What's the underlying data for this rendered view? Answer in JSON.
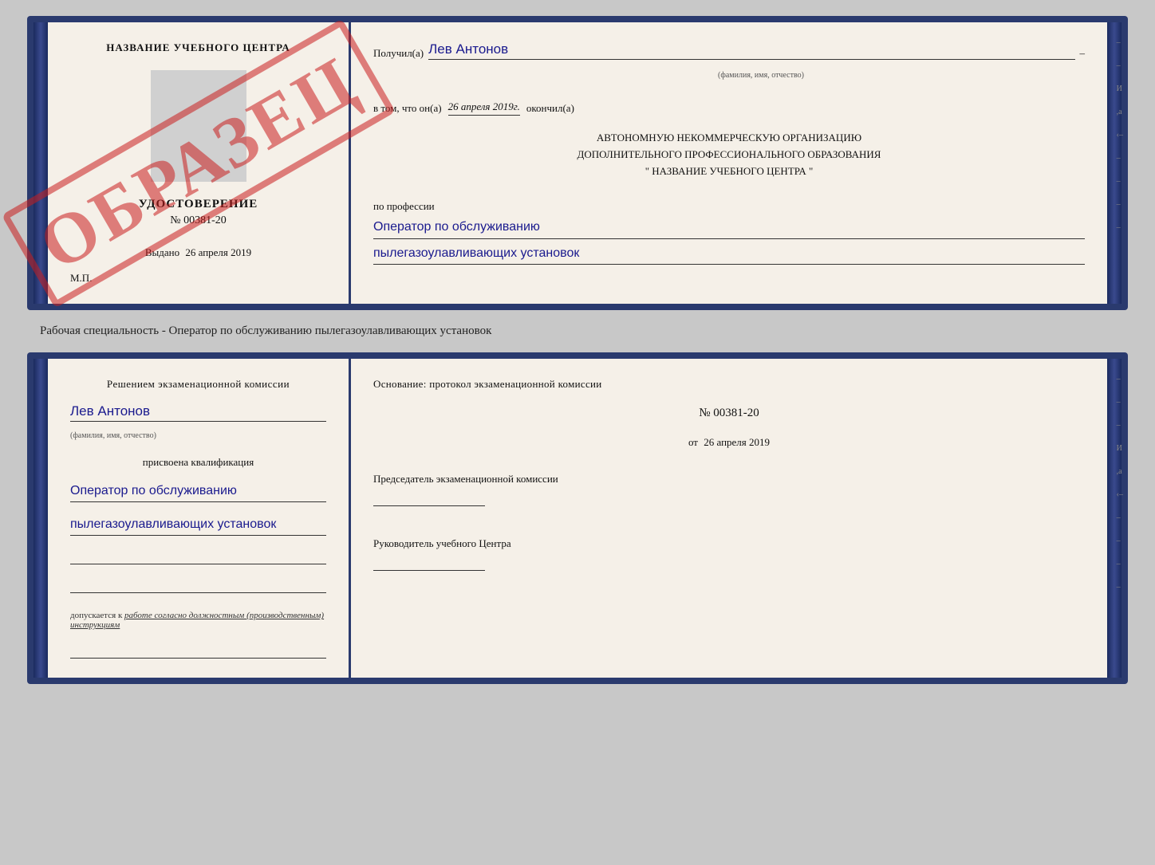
{
  "top_document": {
    "left_page": {
      "center_name": "НАЗВАНИЕ УЧЕБНОГО ЦЕНТРА",
      "watermark": "ОБРАЗЕЦ",
      "udostoverenie_title": "УДОСТОВЕРЕНИЕ",
      "udostoverenie_number": "№ 00381-20",
      "vydano_label": "Выдано",
      "vydano_date": "26 апреля 2019",
      "mp_label": "М.П."
    },
    "right_page": {
      "received_label": "Получил(а)",
      "recipient_name": "Лев Антонов",
      "fio_subtitle": "(фамилия, имя, отчество)",
      "dash": "–",
      "date_prefix": "в том, что он(а)",
      "date_value": "26 апреля 2019г.",
      "date_suffix": "окончил(а)",
      "org_line1": "АВТОНОМНУЮ НЕКОММЕРЧЕСКУЮ ОРГАНИЗАЦИЮ",
      "org_line2": "ДОПОЛНИТЕЛЬНОГО ПРОФЕССИОНАЛЬНОГО ОБРАЗОВАНИЯ",
      "org_line3": "\"   НАЗВАНИЕ УЧЕБНОГО ЦЕНТРА   \"",
      "profession_label": "по профессии",
      "profession_line1": "Оператор по обслуживанию",
      "profession_line2": "пылегазоулавливающих установок"
    }
  },
  "subtitle_text": "Рабочая специальность - Оператор по обслуживанию пылегазоулавливающих установок",
  "bottom_document": {
    "left_page": {
      "komissia_text": "Решением экзаменационной комиссии",
      "name": "Лев Антонов",
      "fio_subtitle": "(фамилия, имя, отчество)",
      "kvaliph_label": "присвоена квалификация",
      "profession_line1": "Оператор по обслуживанию",
      "profession_line2": "пылегазоулавливающих установок",
      "dopusk_prefix": "допускается к",
      "dopusk_italic": "работе согласно должностным (производственным) инструкциям"
    },
    "right_page": {
      "osnovanie_label": "Основание: протокол экзаменационной комиссии",
      "number_label": "№ 00381-20",
      "date_ot_prefix": "от",
      "date_ot_value": "26 апреля 2019",
      "chairman_label": "Председатель экзаменационной комиссии",
      "rukovoditel_label": "Руководитель учебного Центра"
    }
  }
}
